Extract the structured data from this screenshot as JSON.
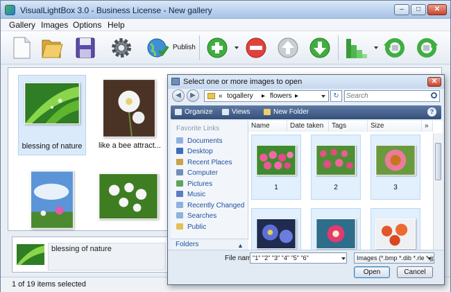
{
  "window": {
    "title": "VisualLightBox 3.0 - Business License - New gallery"
  },
  "menu": [
    "Gallery",
    "Images",
    "Options",
    "Help"
  ],
  "toolbar": {
    "publish_label": "Publish"
  },
  "gallery": {
    "items": [
      {
        "caption": "blessing of nature",
        "selected": true
      },
      {
        "caption": "like a bee attract...",
        "selected": false
      },
      {
        "caption": "",
        "selected": false
      },
      {
        "caption": "",
        "selected": false
      }
    ]
  },
  "info_panel": {
    "text": "blessing of nature"
  },
  "status": {
    "text": "1 of 19 items selected"
  },
  "dialog": {
    "title": "Select one or more images to open",
    "breadcrumb": [
      "«",
      "togallery",
      "▸",
      "flowers",
      "▸"
    ],
    "search_placeholder": "Search",
    "commands": {
      "organize": "Organize",
      "views": "Views",
      "new_folder": "New Folder"
    },
    "favorite_links_header": "Favorite Links",
    "favorites": [
      "Documents",
      "Desktop",
      "Recent Places",
      "Computer",
      "Pictures",
      "Music",
      "Recently Changed",
      "Searches",
      "Public"
    ],
    "folders_label": "Folders",
    "columns": [
      "Name",
      "Date taken",
      "Tags",
      "Size"
    ],
    "files": [
      {
        "name": "1"
      },
      {
        "name": "2"
      },
      {
        "name": "3"
      },
      {
        "name": ""
      },
      {
        "name": ""
      },
      {
        "name": ""
      }
    ],
    "file_name_label": "File name:",
    "file_name_value": "\"1\" \"2\" \"3\" \"4\" \"5\" \"6\"",
    "file_type": "Images (*.bmp *.dib *.rle *.jpg",
    "open_label": "Open",
    "cancel_label": "Cancel"
  }
}
